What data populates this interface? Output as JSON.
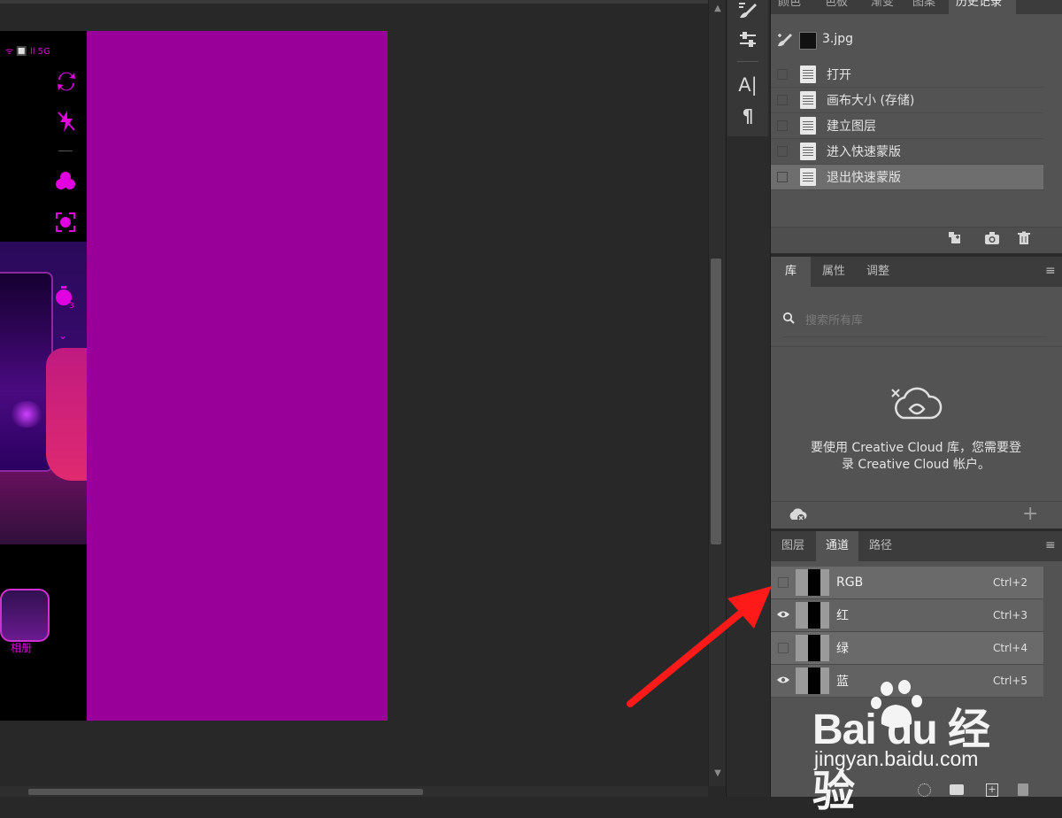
{
  "canvas": {
    "status_icons": "ᯤ 🔲 ll 5G",
    "album_label": "相册"
  },
  "history": {
    "tabs": [
      "颜色",
      "色板",
      "渐变",
      "图案",
      "历史记录"
    ],
    "snapshot_name": "3.jpg",
    "items": [
      "打开",
      "画布大小 (存储)",
      "建立图层",
      "进入快速蒙版",
      "退出快速蒙版"
    ]
  },
  "library": {
    "tabs": [
      "库",
      "属性",
      "调整"
    ],
    "search_placeholder": "搜索所有库",
    "message_line1": "要使用 Creative Cloud 库，您需要登",
    "message_line2": "录 Creative Cloud 帐户。"
  },
  "channels": {
    "tabs": [
      "图层",
      "通道",
      "路径"
    ],
    "items": [
      {
        "name": "RGB",
        "shortcut": "Ctrl+2",
        "visible": false
      },
      {
        "name": "红",
        "shortcut": "Ctrl+3",
        "visible": true
      },
      {
        "name": "绿",
        "shortcut": "Ctrl+4",
        "visible": false
      },
      {
        "name": "蓝",
        "shortcut": "Ctrl+5",
        "visible": true
      }
    ]
  },
  "watermark": {
    "logo_text": "Bai du 经验",
    "url": "jingyan.baidu.com"
  },
  "colors": {
    "canvas_bg": "#282828",
    "magenta_fill": "#990099",
    "panel_bg": "#535353",
    "annotation_arrow": "#ff1a1a"
  }
}
